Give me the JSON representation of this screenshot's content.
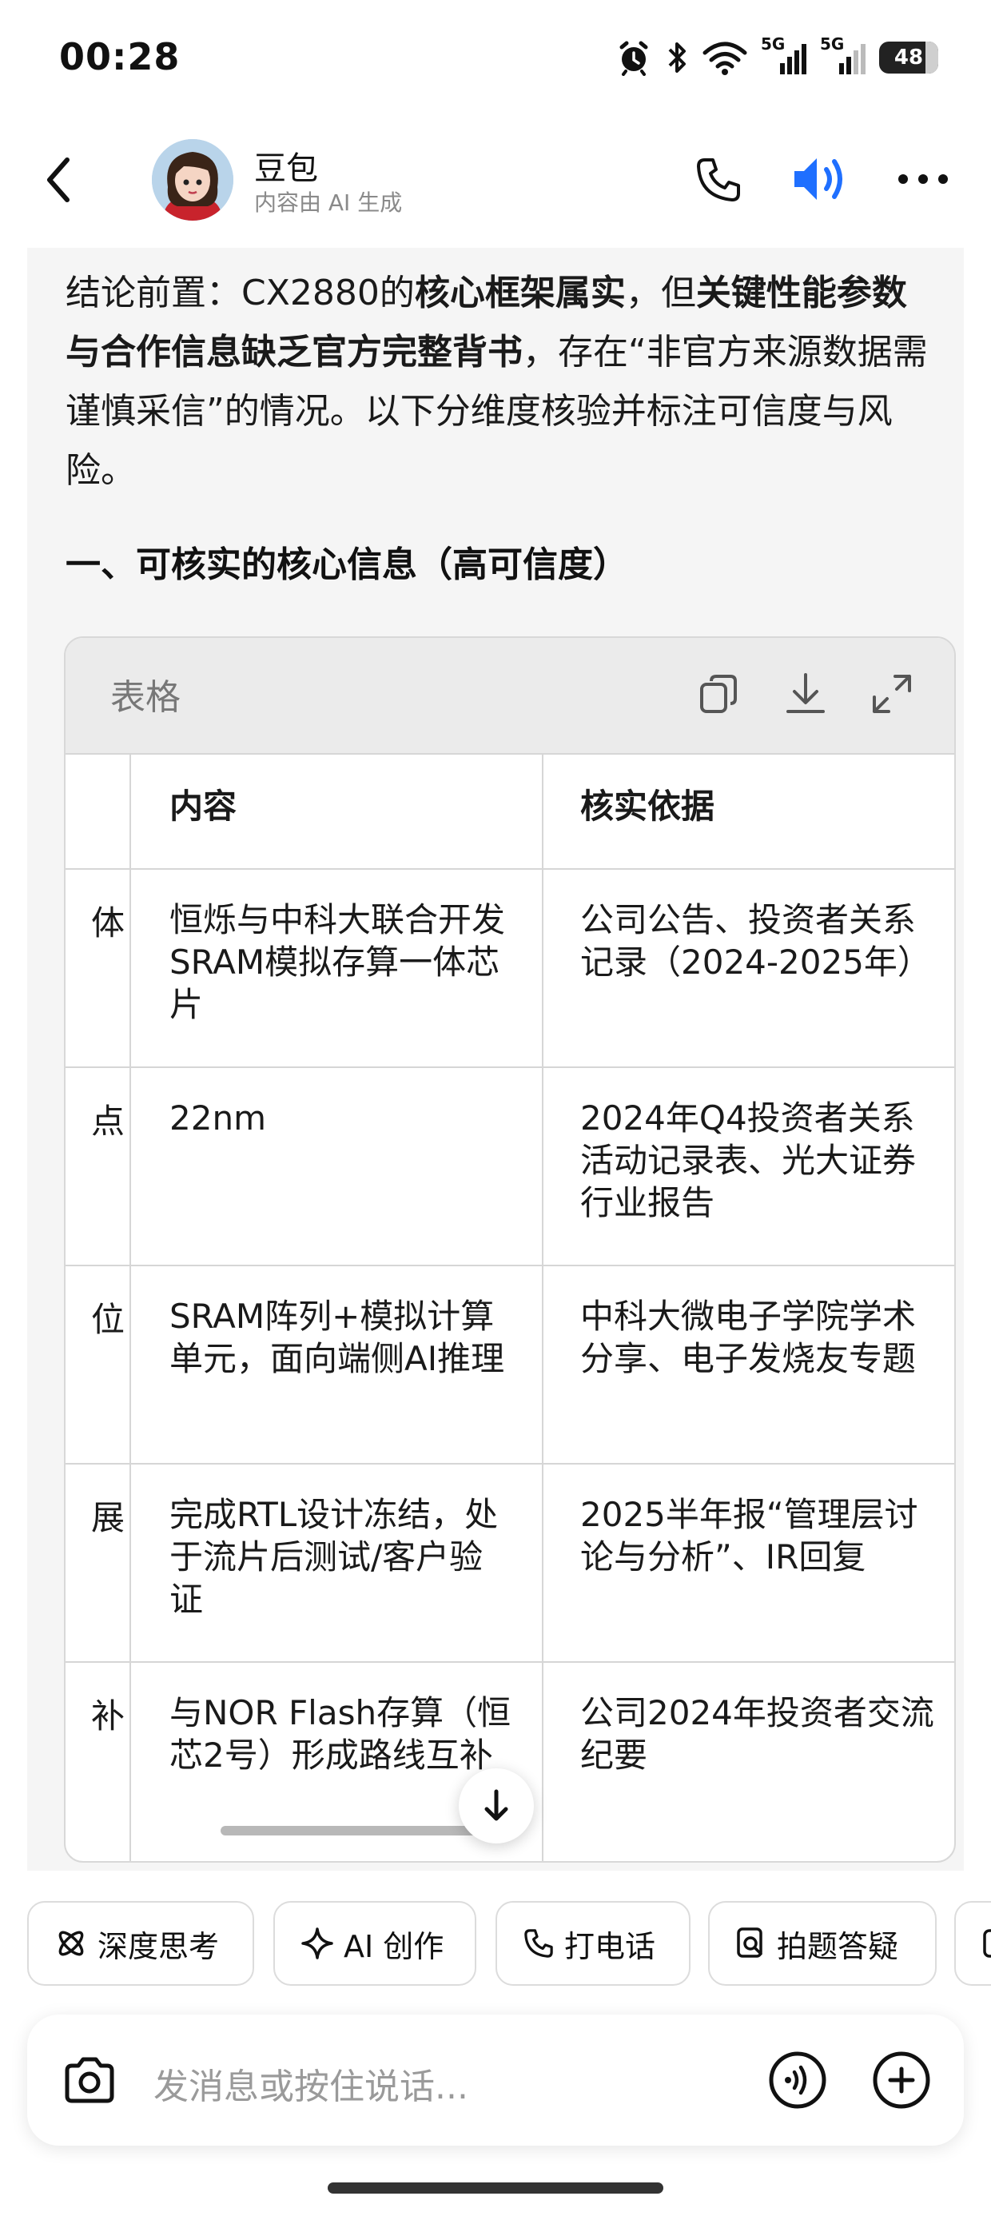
{
  "status_bar": {
    "time": "00:28",
    "network_1": "5G",
    "network_2": "5G",
    "battery": "48",
    "icons": [
      "alarm-icon",
      "bluetooth-icon",
      "wifi-icon",
      "signal-icon",
      "signal-icon",
      "battery-icon"
    ]
  },
  "header": {
    "name": "豆包",
    "subtitle": "内容由 AI 生成"
  },
  "message": {
    "p_1": "结论前置：CX2880的",
    "p_b1": "核心框架属实",
    "p_2": "，但",
    "p_b2": "关键性能参数与合作信息缺乏官方完整背书",
    "p_3": "，存在“非官方来源数据需谨慎采信”的情况。以下分维度核验并标注可信度与风险。",
    "section_title": "一、可核实的核心信息（高可信度）"
  },
  "table": {
    "title": "表格",
    "columns": [
      "",
      "内容",
      "核实依据"
    ],
    "rows": [
      {
        "c0": "体",
        "c1": "恒烁与中科大联合开发SRAM模拟存算一体芯片",
        "c2": "公司公告、投资者关系记录（2024-2025年）"
      },
      {
        "c0": "点",
        "c1": "22nm",
        "c2": "2024年Q4投资者关系活动记录表、光大证券行业报告"
      },
      {
        "c0": "位",
        "c1": "SRAM阵列+模拟计算单元，面向端侧AI推理",
        "c2": "中科大微电子学院学术分享、电子发烧友专题"
      },
      {
        "c0": "展",
        "c1": "完成RTL设计冻结，处于流片后测试/客户验证",
        "c2": "2025半年报“管理层讨论与分析”、IR回复"
      },
      {
        "c0": "补",
        "c1": "与NOR Flash存算（恒芯2号）形成路线互补",
        "c2": "公司2024年投资者交流纪要"
      }
    ]
  },
  "chips": [
    "深度思考",
    "AI 创作",
    "打电话",
    "拍题答疑"
  ],
  "input": {
    "placeholder": "发消息或按住说话..."
  },
  "colors": {
    "accent_blue": "#1f6fff",
    "bubble_bg": "#f5f5f5"
  }
}
